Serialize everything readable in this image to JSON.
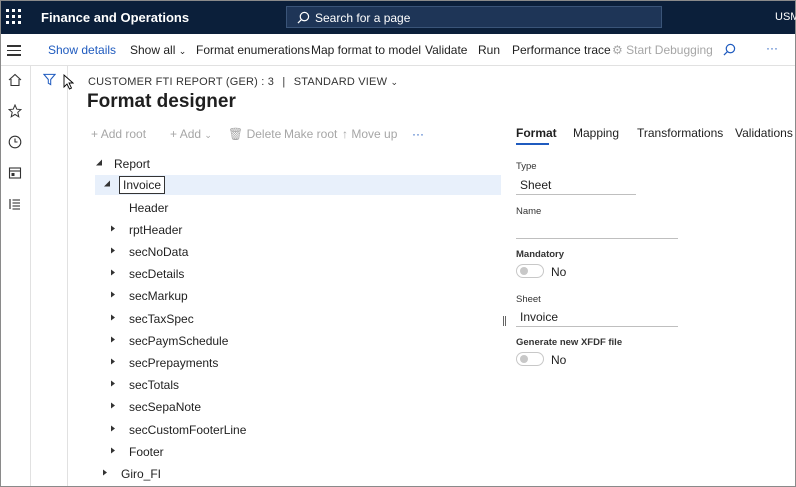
{
  "app": {
    "title": "Finance and Operations",
    "search_placeholder": "Search for a page",
    "company": "USM"
  },
  "actions": {
    "show_details": "Show details",
    "show_all": "Show all",
    "format_enumerations": "Format enumerations",
    "map_format": "Map format to model",
    "validate": "Validate",
    "run": "Run",
    "performance_trace": "Performance trace",
    "start_debugging": "Start Debugging",
    "more": "···"
  },
  "page": {
    "breadcrumb": "CUSTOMER FTI REPORT (GER) : 3",
    "separator": "|",
    "view": "STANDARD VIEW",
    "title": "Format designer"
  },
  "toolbar": {
    "add_root": "Add root",
    "add": "Add",
    "delete": "Delete",
    "make_root": "Make root",
    "move_up": "Move up",
    "more": "···"
  },
  "tree": {
    "report": "Report",
    "invoice": "Invoice",
    "children": [
      "Header",
      "rptHeader",
      "secNoData",
      "secDetails",
      "secMarkup",
      "secTaxSpec",
      "secPaymSchedule",
      "secPrepayments",
      "secTotals",
      "secSepaNote",
      "secCustomFooterLine",
      "Footer"
    ],
    "giro": "Giro_FI"
  },
  "tabs": {
    "format": "Format",
    "mapping": "Mapping",
    "transformations": "Transformations",
    "validations": "Validations"
  },
  "details": {
    "type_label": "Type",
    "type_value": "Sheet",
    "name_label": "Name",
    "name_value": "",
    "mandatory_label": "Mandatory",
    "mandatory_value": "No",
    "sheet_label": "Sheet",
    "sheet_value": "Invoice",
    "xfdf_label": "Generate new XFDF file",
    "xfdf_value": "No"
  },
  "colors": {
    "topbar": "#0b1f3a",
    "accent": "#1f5bbf",
    "selected_row": "#e8f0fb"
  }
}
